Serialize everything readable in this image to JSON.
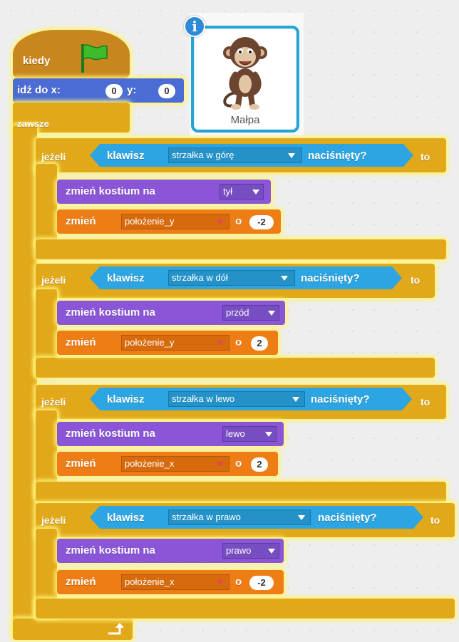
{
  "event_block": {
    "label": "kiedy",
    "icon": "green-flag-icon",
    "color": "#c8861f"
  },
  "goto_block": {
    "label": "idź do x:",
    "x": "0",
    "y_label": "y:",
    "y": "0",
    "color": "#4a6cd4"
  },
  "forever_block": {
    "label": "zawsze",
    "color": "#e1a91a",
    "end_icon": "loop-arrow-icon"
  },
  "sprite": {
    "name": "Małpa",
    "info_icon": "i"
  },
  "if_blocks": [
    {
      "if_label": "jeżeli",
      "sensing": {
        "label": "klawisz",
        "key": "strzałka w górę",
        "suffix": "naciśnięty?"
      },
      "then_label": "to",
      "costume": {
        "label": "zmień kostium na",
        "value": "tył"
      },
      "var_change": {
        "label": "zmień",
        "variable": "położenie_y",
        "by": "o",
        "amount": "-2"
      }
    },
    {
      "if_label": "jeżeli",
      "sensing": {
        "label": "klawisz",
        "key": "strzałka w dół",
        "suffix": "naciśnięty?"
      },
      "then_label": "to",
      "costume": {
        "label": "zmień kostium na",
        "value": "przód"
      },
      "var_change": {
        "label": "zmień",
        "variable": "położenie_y",
        "by": "o",
        "amount": "2"
      }
    },
    {
      "if_label": "jeżeli",
      "sensing": {
        "label": "klawisz",
        "key": "strzałka w lewo",
        "suffix": "naciśnięty?"
      },
      "then_label": "to",
      "costume": {
        "label": "zmień kostium na",
        "value": "lewo"
      },
      "var_change": {
        "label": "zmień",
        "variable": "położenie_x",
        "by": "o",
        "amount": "2"
      }
    },
    {
      "if_label": "jeżeli",
      "sensing": {
        "label": "klawisz",
        "key": "strzałka w prawo",
        "suffix": "naciśnięty?"
      },
      "then_label": "to",
      "costume": {
        "label": "zmień kostium na",
        "value": "prawo"
      },
      "var_change": {
        "label": "zmień",
        "variable": "położenie_x",
        "by": "o",
        "amount": "-2"
      }
    }
  ],
  "colors": {
    "control": "#e1a91a",
    "sensing": "#2ca5e2",
    "looks": "#8a55d7",
    "data": "#ee7d16",
    "motion": "#4a6cd4",
    "events": "#c8861f",
    "highlight": "#fff478"
  }
}
